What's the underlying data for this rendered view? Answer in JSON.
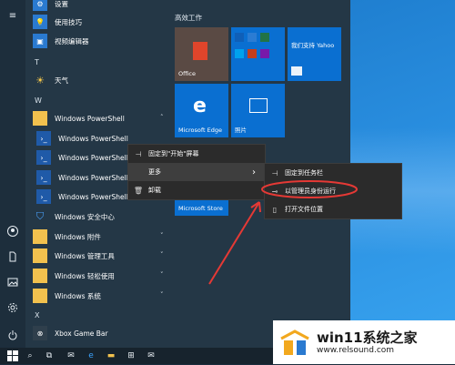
{
  "app_list": {
    "settings_label": "设置",
    "tips_label": "使用技巧",
    "video_editor_label": "视频编辑器",
    "letter_t": "T",
    "weather_label": "天气",
    "letter_w": "W",
    "powershell_folder_label": "Windows PowerShell",
    "powershell_items": [
      "Windows PowerShell",
      "Windows PowerShell",
      "Windows PowerShell",
      "Windows PowerShell"
    ],
    "security_label": "Windows 安全中心",
    "accessories_label": "Windows 附件",
    "admin_tools_label": "Windows 管理工具",
    "ease_label": "Windows 轻松使用",
    "system_label": "Windows 系统",
    "letter_x": "X",
    "xbox_label": "Xbox Game Bar"
  },
  "tiles": {
    "section_title": "高效工作",
    "office_label": "Office",
    "yahoo_label": "我们支持 Yahoo",
    "edge_label": "Microsoft Edge",
    "photos_label": "照片",
    "store_label": "Microsoft Store"
  },
  "context_menu": {
    "pin_start": "固定到\"开始\"屏幕",
    "more": "更多",
    "uninstall": "卸载"
  },
  "submenu": {
    "pin_taskbar": "固定到任务栏",
    "run_as_admin": "以管理员身份运行",
    "open_location": "打开文件位置"
  },
  "watermark": {
    "title": "win11系统之家",
    "url": "www.relsound.com"
  },
  "colors": {
    "start_bg": "#243746",
    "tile_blue": "#0a6fd1",
    "office_tile": "#5a4a44",
    "annotation_red": "#e53935"
  },
  "icons": {
    "hamburger": "≡",
    "chevron_right": "›",
    "chevron_up": "˄",
    "chevron_down": "˅"
  }
}
